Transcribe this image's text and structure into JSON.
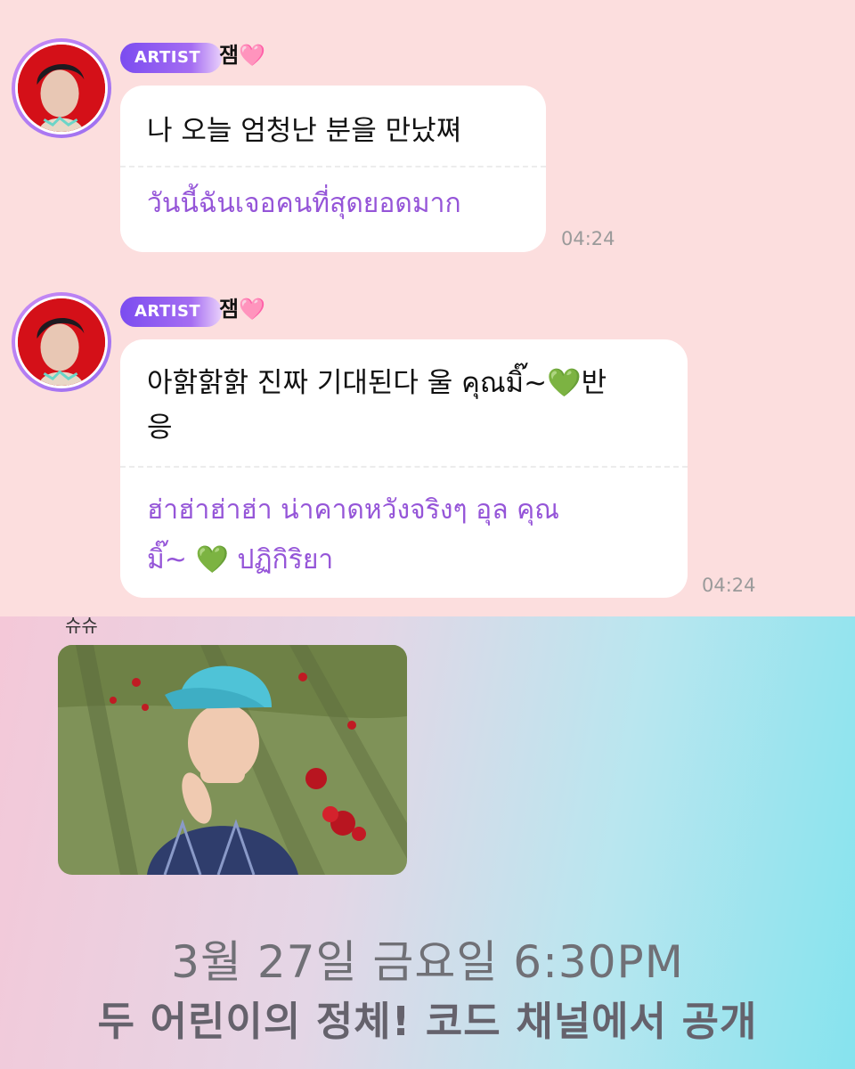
{
  "messages": [
    {
      "badge": "ARTIST",
      "sender_name": "잼",
      "sender_heart": "🩷",
      "original": "나 오늘 엄청난 분을 만났쪄",
      "translation": "วันนี้ฉันเจอคนที่สุดยอดมาก",
      "time": "04:24"
    },
    {
      "badge": "ARTIST",
      "sender_name": "잼",
      "sender_heart": "🩷",
      "original_line1": "아핡핡핡 진짜 기대된다 울 คุณมิ๊~",
      "original_emoji": "💚",
      "original_line1_end": "반",
      "original_line2": "응",
      "translation_line1": "ฮ่าฮ่าฮ่าฮ่า น่าคาดหวังจริงๆ อุล คุณ",
      "translation_line2_start": "มิ๊~",
      "translation_emoji": "💚",
      "translation_line2_end": "ปฏิกิริยา",
      "time": "04:24"
    }
  ],
  "promo": {
    "author": "슈슈",
    "date_text": "3월 27일 금요일 6:30PM",
    "title_text": "두 어린이의 정체! 코드 채널에서 공개"
  },
  "icons": {
    "avatar": "artist-avatar",
    "heart": "pink-heart-icon",
    "green_heart": "green-heart-icon"
  },
  "colors": {
    "chat_background": "#fcdede",
    "badge_gradient_start": "#7b4cf0",
    "translation_text": "#9555d8"
  }
}
